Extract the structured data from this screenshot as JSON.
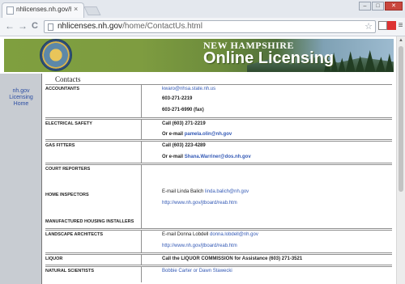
{
  "browser": {
    "tab_title": "nhlicenses.nh.gov/home",
    "tab_close": "×",
    "url_host": "nhlicenses.nh.gov",
    "url_path": "/home/ContactUs.html",
    "nav_back": "←",
    "nav_forward": "→",
    "nav_reload": "C",
    "star": "☆",
    "menu": "≡",
    "min": "–",
    "max": "□",
    "close": "✕"
  },
  "banner": {
    "title_small": "NEW HAMPSHIRE",
    "title_big": "Online Licensing"
  },
  "side_nav": {
    "home_link": "nh.gov Licensing Home"
  },
  "page": {
    "title": "Contacts"
  },
  "contacts": {
    "accountants": {
      "category": "ACCOUNTANTS",
      "email": "kwaro@nhsa.state.nh.us",
      "phone": "603-271-2219",
      "fax": "603-271-6990 (fax)"
    },
    "electrical": {
      "category": "ELECTRICAL SAFETY",
      "call": "Call (603) 271-2219",
      "email_prefix": "Or e-mail",
      "email": "pamela.olin@nh.gov"
    },
    "gas": {
      "category": "GAS FITTERS",
      "call": "Call (603) 223-4289",
      "email_prefix": "Or e-mail",
      "email": "Shana.Warriner@dos.nh.gov"
    },
    "group": {
      "cat1": "COURT REPORTERS",
      "cat2": "HOME INSPECTORS",
      "cat3": "MANUFACTURED HOUSING INSTALLERS",
      "email_prefix": "E-mail Linda Balich",
      "email": "linda.balich@nh.gov",
      "url": "http://www.nh.gov/jtboard/reab.htm"
    },
    "landscape": {
      "category": "LANDSCAPE ARCHITECTS",
      "email_prefix": "E-mail Donna Lobdell",
      "email": "donna.lobdell@nh.gov",
      "url": "http://www.nh.gov/jtboard/reab.htm"
    },
    "liquor": {
      "category": "LIQUOR",
      "text": "Call the LIQUOR COMMISSION for Assistance (603) 271-3521"
    },
    "natural": {
      "category": "NATURAL SCIENTISTS",
      "names": "Bobbie Carter or Dawn Stawecki"
    }
  }
}
